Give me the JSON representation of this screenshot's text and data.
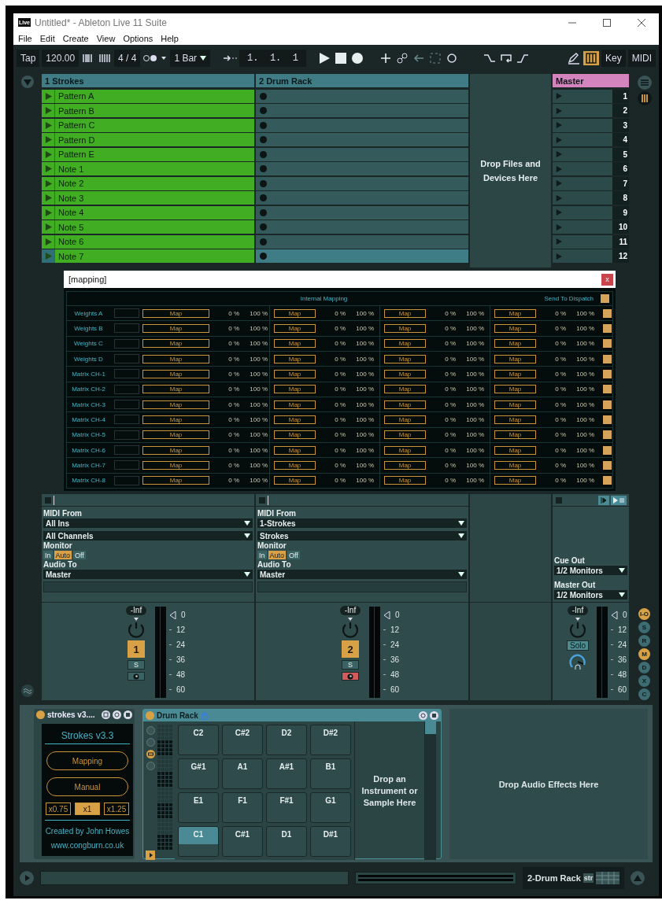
{
  "window": {
    "title": "Untitled* - Ableton Live 11 Suite",
    "logo": "Live"
  },
  "menu": [
    "File",
    "Edit",
    "Create",
    "View",
    "Options",
    "Help"
  ],
  "toolbar": {
    "tap": "Tap",
    "tempo": "120.00",
    "signature": "4 / 4",
    "quantize": "1 Bar",
    "position": "1.  1.  1",
    "keyboard_on": true,
    "key": "Key",
    "midi": "MIDI"
  },
  "session": {
    "tracks": [
      {
        "name": "1 Strokes",
        "kind": "clips",
        "clips": [
          "Pattern A",
          "Pattern B",
          "Pattern C",
          "Pattern D",
          "Pattern E",
          "Note 1",
          "Note 2",
          "Note 3",
          "Note 4",
          "Note 5",
          "Note 6",
          "Note 7"
        ]
      },
      {
        "name": "2 Drum Rack",
        "kind": "empty"
      }
    ],
    "drop_hint": "Drop Files and Devices Here",
    "master": "Master",
    "scenes": [
      {
        "number": "1",
        "selected": false
      },
      {
        "number": "2",
        "selected": false
      },
      {
        "number": "3",
        "selected": false
      },
      {
        "number": "4",
        "selected": false
      },
      {
        "number": "5",
        "selected": false
      },
      {
        "number": "6",
        "selected": false
      },
      {
        "number": "7",
        "selected": false
      },
      {
        "number": "8",
        "selected": false
      },
      {
        "number": "9",
        "selected": false
      },
      {
        "number": "10",
        "selected": false
      },
      {
        "number": "11",
        "selected": false
      },
      {
        "number": "12",
        "selected": true
      }
    ]
  },
  "mapping": {
    "title": "[mapping]",
    "close": "x",
    "heading": "Internal Mapping",
    "dispatch": "Send To Dispatch",
    "dispatch_checked": true,
    "rows": [
      {
        "label": "Weights A",
        "checked": true,
        "slots": [
          [
            "Map",
            "0 %",
            "100 %"
          ],
          [
            "Map",
            "0 %",
            "100 %"
          ],
          [
            "Map",
            "0 %",
            "100 %"
          ],
          [
            "Map",
            "0 %",
            "100 %"
          ]
        ]
      },
      {
        "label": "Weights B",
        "checked": true,
        "slots": [
          [
            "Map",
            "0 %",
            "100 %"
          ],
          [
            "Map",
            "0 %",
            "100 %"
          ],
          [
            "Map",
            "0 %",
            "100 %"
          ],
          [
            "Map",
            "0 %",
            "100 %"
          ]
        ]
      },
      {
        "label": "Weights C",
        "checked": true,
        "slots": [
          [
            "Map",
            "0 %",
            "100 %"
          ],
          [
            "Map",
            "0 %",
            "100 %"
          ],
          [
            "Map",
            "0 %",
            "100 %"
          ],
          [
            "Map",
            "0 %",
            "100 %"
          ]
        ]
      },
      {
        "label": "Weights D",
        "checked": true,
        "slots": [
          [
            "Map",
            "0 %",
            "100 %"
          ],
          [
            "Map",
            "0 %",
            "100 %"
          ],
          [
            "Map",
            "0 %",
            "100 %"
          ],
          [
            "Map",
            "0 %",
            "100 %"
          ]
        ]
      },
      {
        "label": "Matrix CH-1",
        "checked": true,
        "slots": [
          [
            "Map",
            "0 %",
            "100 %"
          ],
          [
            "Map",
            "0 %",
            "100 %"
          ],
          [
            "Map",
            "0 %",
            "100 %"
          ],
          [
            "Map",
            "0 %",
            "100 %"
          ]
        ]
      },
      {
        "label": "Matrix CH-2",
        "checked": true,
        "slots": [
          [
            "Map",
            "0 %",
            "100 %"
          ],
          [
            "Map",
            "0 %",
            "100 %"
          ],
          [
            "Map",
            "0 %",
            "100 %"
          ],
          [
            "Map",
            "0 %",
            "100 %"
          ]
        ]
      },
      {
        "label": "Matrix CH-3",
        "checked": true,
        "slots": [
          [
            "Map",
            "0 %",
            "100 %"
          ],
          [
            "Map",
            "0 %",
            "100 %"
          ],
          [
            "Map",
            "0 %",
            "100 %"
          ],
          [
            "Map",
            "0 %",
            "100 %"
          ]
        ]
      },
      {
        "label": "Matrix CH-4",
        "checked": true,
        "slots": [
          [
            "Map",
            "0 %",
            "100 %"
          ],
          [
            "Map",
            "0 %",
            "100 %"
          ],
          [
            "Map",
            "0 %",
            "100 %"
          ],
          [
            "Map",
            "0 %",
            "100 %"
          ]
        ]
      },
      {
        "label": "Matrix CH-5",
        "checked": true,
        "slots": [
          [
            "Map",
            "0 %",
            "100 %"
          ],
          [
            "Map",
            "0 %",
            "100 %"
          ],
          [
            "Map",
            "0 %",
            "100 %"
          ],
          [
            "Map",
            "0 %",
            "100 %"
          ]
        ]
      },
      {
        "label": "Matrix CH-6",
        "checked": true,
        "slots": [
          [
            "Map",
            "0 %",
            "100 %"
          ],
          [
            "Map",
            "0 %",
            "100 %"
          ],
          [
            "Map",
            "0 %",
            "100 %"
          ],
          [
            "Map",
            "0 %",
            "100 %"
          ]
        ]
      },
      {
        "label": "Matrix CH-7",
        "checked": true,
        "slots": [
          [
            "Map",
            "0 %",
            "100 %"
          ],
          [
            "Map",
            "0 %",
            "100 %"
          ],
          [
            "Map",
            "0 %",
            "100 %"
          ],
          [
            "Map",
            "0 %",
            "100 %"
          ]
        ]
      },
      {
        "label": "Matrix CH-8",
        "checked": true,
        "slots": [
          [
            "Map",
            "0 %",
            "100 %"
          ],
          [
            "Map",
            "0 %",
            "100 %"
          ],
          [
            "Map",
            "0 %",
            "100 %"
          ],
          [
            "Map",
            "0 %",
            "100 %"
          ]
        ]
      }
    ]
  },
  "io": {
    "tracks": [
      {
        "midi_from": "MIDI From",
        "input": "All Ins",
        "channel": "All Channels",
        "monitor_label": "Monitor",
        "monitor": [
          {
            "label": "In",
            "selected": false
          },
          {
            "label": "Auto",
            "selected": true
          },
          {
            "label": "Off",
            "selected": false
          }
        ],
        "audio_to": "Audio To",
        "output": "Master"
      },
      {
        "midi_from": "MIDI From",
        "input": "1-Strokes",
        "channel": "Strokes",
        "monitor_label": "Monitor",
        "monitor": [
          {
            "label": "In",
            "selected": false
          },
          {
            "label": "Auto",
            "selected": true
          },
          {
            "label": "Off",
            "selected": false
          }
        ],
        "audio_to": "Audio To",
        "output": "Master"
      }
    ],
    "master": {
      "cue_out": "Cue Out",
      "cue_target": "1/2 Monitors",
      "master_out": "Master Out",
      "master_target": "1/2 Monitors"
    }
  },
  "mixer": {
    "strips": [
      {
        "volume": "-Inf",
        "number": "1",
        "solo": "S",
        "armed": false,
        "scale": [
          "0",
          "12",
          "24",
          "36",
          "48",
          "60"
        ]
      },
      {
        "volume": "-Inf",
        "number": "2",
        "solo": "S",
        "armed": true,
        "scale": [
          "0",
          "12",
          "24",
          "36",
          "48",
          "60"
        ]
      }
    ],
    "master": {
      "volume": "-Inf",
      "solo": "Solo",
      "scale": [
        "0",
        "12",
        "24",
        "36",
        "48",
        "60"
      ]
    }
  },
  "side_buttons": [
    {
      "label": "I-O",
      "selected": true
    },
    {
      "label": "S",
      "selected": false
    },
    {
      "label": "R",
      "selected": false
    },
    {
      "label": "M",
      "selected": true
    },
    {
      "label": "D",
      "selected": false
    },
    {
      "label": "X",
      "selected": false
    },
    {
      "label": "C",
      "selected": false
    }
  ],
  "devices": {
    "strokes": {
      "title": "strokes v3....",
      "name": "Strokes v3.3",
      "buttons": [
        "Mapping",
        "Manual"
      ],
      "speeds": [
        {
          "label": "x0.75",
          "selected": false
        },
        {
          "label": "x1",
          "selected": true
        },
        {
          "label": "x1.25",
          "selected": false
        }
      ],
      "credit": "Created by John Howes",
      "url": "www.congburn.co.uk"
    },
    "drum_rack": {
      "title": "Drum Rack",
      "pads": [
        {
          "label": "C2",
          "selected": false
        },
        {
          "label": "C#2",
          "selected": false
        },
        {
          "label": "D2",
          "selected": false
        },
        {
          "label": "D#2",
          "selected": false
        },
        {
          "label": "G#1",
          "selected": false
        },
        {
          "label": "A1",
          "selected": false
        },
        {
          "label": "A#1",
          "selected": false
        },
        {
          "label": "B1",
          "selected": false
        },
        {
          "label": "E1",
          "selected": false
        },
        {
          "label": "F1",
          "selected": false
        },
        {
          "label": "F#1",
          "selected": false
        },
        {
          "label": "G1",
          "selected": false
        },
        {
          "label": "C1",
          "selected": true
        },
        {
          "label": "C#1",
          "selected": false
        },
        {
          "label": "D1",
          "selected": false
        },
        {
          "label": "D#1",
          "selected": false
        }
      ],
      "drop_hint": "Drop an Instrument or Sample Here"
    },
    "effects_hint": "Drop Audio Effects Here"
  },
  "status": {
    "track": "2-Drum Rack",
    "device": "str"
  }
}
